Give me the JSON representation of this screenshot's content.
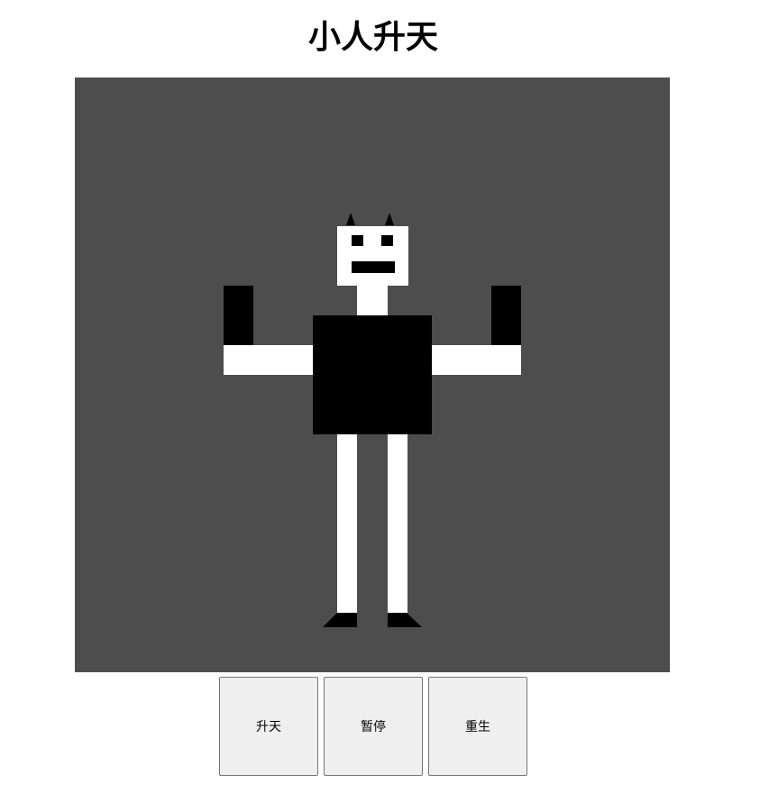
{
  "page": {
    "title": "小人升天"
  },
  "stage": {
    "background_color": "#4d4d4d",
    "figure_colors": {
      "primary": "#000000",
      "secondary": "#ffffff"
    }
  },
  "controls": {
    "ascend_label": "升天",
    "pause_label": "暂停",
    "respawn_label": "重生"
  }
}
